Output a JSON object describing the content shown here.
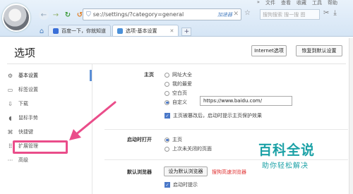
{
  "chrome": {
    "topmenu": [
      "»",
      "文件",
      "查看",
      "收藏",
      "工具",
      "帮助"
    ],
    "url": "se://settings/?category=general",
    "url_tag": "加速器",
    "search_placeholder": "搜狗搜索 搜一搜 图",
    "tabs": [
      {
        "label": "百度一下，你就知道",
        "active": false,
        "color": "#3a6fd8"
      },
      {
        "label": "选项-基本设置",
        "active": true,
        "color": "#4a90d9"
      }
    ],
    "newtab": "+"
  },
  "page": {
    "title": "选项",
    "buttons": {
      "internet_options": "Internet选项",
      "restore_defaults": "恢复到默认设置"
    }
  },
  "sidebar": {
    "items": [
      {
        "label": "基本设置",
        "icon": "gear-icon",
        "glyph": "⚙",
        "active": true
      },
      {
        "label": "标签设置",
        "icon": "tab-icon",
        "glyph": "▭",
        "active": false
      },
      {
        "label": "下载",
        "icon": "download-icon",
        "glyph": "⇩",
        "active": false
      },
      {
        "label": "鼠标手势",
        "icon": "mouse-icon",
        "glyph": "◖",
        "active": false
      },
      {
        "label": "快捷键",
        "icon": "shortcut-icon",
        "glyph": "⌘",
        "active": false
      },
      {
        "label": "扩展管理",
        "icon": "extension-icon",
        "glyph": "⠿",
        "active": false
      },
      {
        "label": "高级",
        "icon": "more-icon",
        "glyph": "···",
        "active": false
      }
    ]
  },
  "homepage": {
    "label": "主页",
    "options": [
      "网址大全",
      "我的最爱",
      "空白页",
      "自定义"
    ],
    "selected": "自定义",
    "custom_url": "https://www.baidu.com/",
    "protect_label": "主页被篡改后，启动时提示主页保护效果",
    "protect_checked": true
  },
  "startup": {
    "label": "启动时打开",
    "options": [
      "主页",
      "上次未关闭的页面"
    ],
    "selected": "主页"
  },
  "default_browser": {
    "label": "默认浏览器",
    "button": "设为默认浏览器",
    "status": "搜狗高速浏览器",
    "prompt_label": "启动时提示",
    "prompt_checked": true
  },
  "watermark": {
    "big": "百科全说",
    "small": "助你轻松解决"
  },
  "colors": {
    "accent": "#4a78c8",
    "highlight": "#ea4d8a",
    "watermark": "#1ba1a6"
  }
}
